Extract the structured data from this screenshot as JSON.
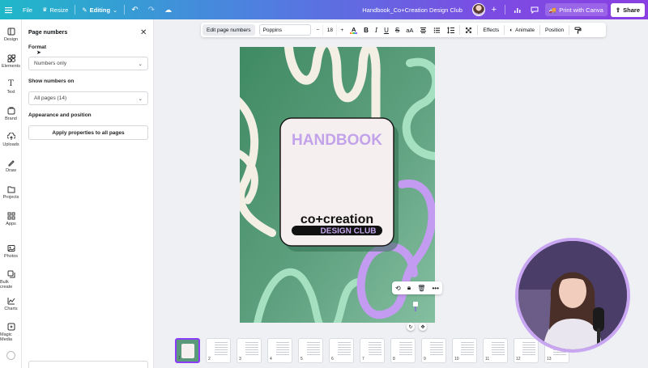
{
  "topbar": {
    "file_label": "File",
    "resize_label": "Resize",
    "editing_label": "Editing",
    "doc_title": "Handbook_Co+Creation Design Club",
    "print_label": "Print with Canva",
    "share_label": "Share"
  },
  "rail": {
    "items": [
      {
        "label": "Design",
        "icon": "design-icon"
      },
      {
        "label": "Elements",
        "icon": "elements-icon"
      },
      {
        "label": "Text",
        "icon": "text-icon"
      },
      {
        "label": "Brand",
        "icon": "brand-icon"
      },
      {
        "label": "Uploads",
        "icon": "uploads-icon"
      },
      {
        "label": "Draw",
        "icon": "draw-icon"
      },
      {
        "label": "Projects",
        "icon": "folder-icon"
      },
      {
        "label": "Apps",
        "icon": "apps-icon"
      },
      {
        "label": "Photos",
        "icon": "photos-icon"
      },
      {
        "label": "Bulk create",
        "icon": "bulk-create-icon"
      },
      {
        "label": "Charts",
        "icon": "charts-icon"
      },
      {
        "label": "Magic Media",
        "icon": "magic-media-icon"
      }
    ]
  },
  "panel": {
    "title": "Page numbers",
    "format_label": "Format",
    "format_value": "Numbers only",
    "show_label": "Show numbers on",
    "show_value": "All pages (14)",
    "appearance_label": "Appearance and position",
    "apply_button": "Apply properties to all pages"
  },
  "context_toolbar": {
    "edit_page_numbers": "Edit page numbers",
    "font": "Poppins",
    "size_minus": "−",
    "font_size": "18",
    "size_plus": "+",
    "color_letter": "A",
    "bold": "B",
    "italic": "I",
    "underline": "U",
    "strike": "S",
    "case": "aA",
    "effects": "Effects",
    "animate": "Animate",
    "position": "Position"
  },
  "canvas": {
    "headline": "HANDBOOK",
    "logo_line1": "co+creation",
    "logo_line2": "DESIGN CLUB",
    "colors": {
      "background": "#5a9a7a",
      "card": "#f6eff0",
      "headline": "#c2a3ea",
      "squiggle_light": "#a5e0c0",
      "squiggle_purple": "#c39bf0"
    }
  },
  "thumbnails": [
    "1",
    "2",
    "3",
    "4",
    "5",
    "6",
    "7",
    "8",
    "9",
    "10",
    "11",
    "12",
    "13"
  ],
  "accent": "#8b3dff"
}
